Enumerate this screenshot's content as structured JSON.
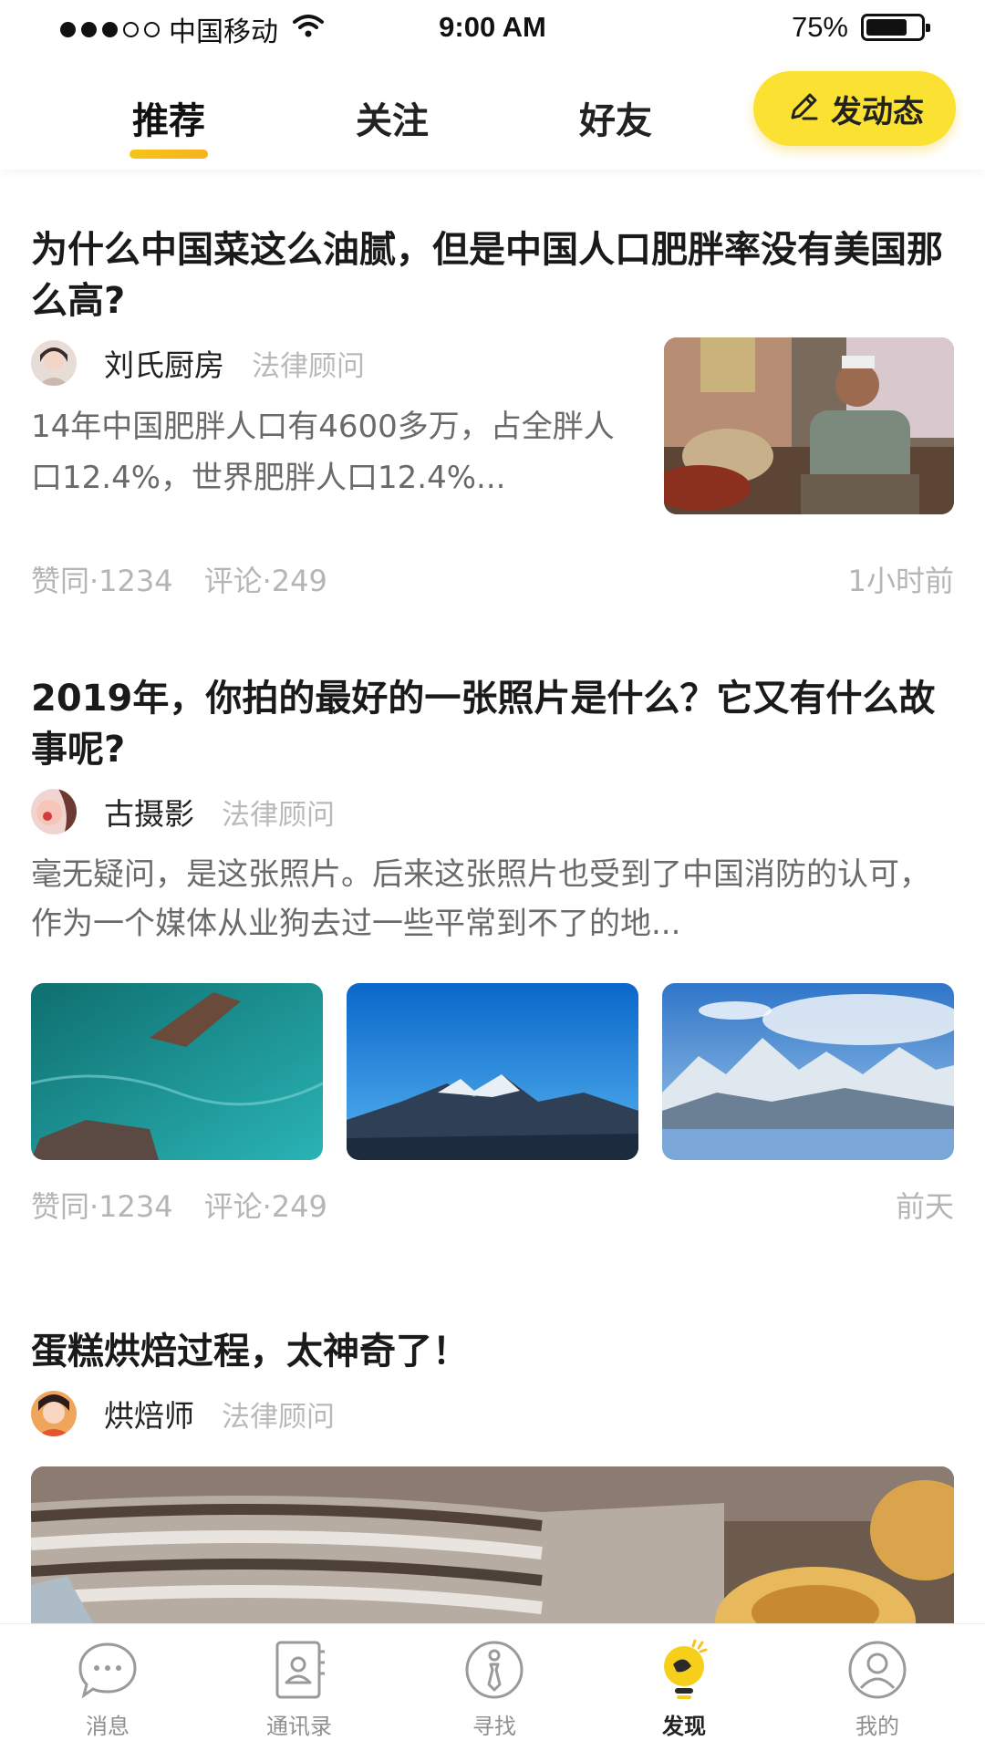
{
  "status_bar": {
    "carrier": "中国移动",
    "time": "9:00 AM",
    "battery": "75%",
    "battery_level": 0.75
  },
  "top_tabs": [
    {
      "label": "推荐",
      "active": true
    },
    {
      "label": "关注",
      "active": false
    },
    {
      "label": "好友",
      "active": false
    }
  ],
  "post_button": {
    "label": "发动态",
    "icon": "pencil-icon"
  },
  "posts": [
    {
      "title": "为什么中国菜这么油腻，但是中国人口肥胖率没有美国那么高?",
      "author": "刘氏厨房",
      "role": "法律顾问",
      "excerpt": "14年中国肥胖人口有4600多万，占全胖人口12.4%，世界肥胖人口12.4%...",
      "likes": "赞同·1234",
      "comments": "评论·249",
      "time": "1小时前"
    },
    {
      "title": "2019年，你拍的最好的一张照片是什么？它又有什么故事呢?",
      "author": "古摄影",
      "role": "法律顾问",
      "excerpt": "毫无疑问，是这张照片。后来这张照片也受到了中国消防的认可，作为一个媒体从业狗去过一些平常到不了的地...",
      "likes": "赞同·1234",
      "comments": "评论·249",
      "time": "前天"
    },
    {
      "title": "蛋糕烘焙过程，太神奇了！",
      "author": "烘焙师",
      "role": "法律顾问"
    }
  ],
  "bottom_nav": [
    {
      "label": "消息",
      "icon": "chat-bubble-icon",
      "active": false
    },
    {
      "label": "通讯录",
      "icon": "contacts-book-icon",
      "active": false
    },
    {
      "label": "寻找",
      "icon": "tie-person-icon",
      "active": false
    },
    {
      "label": "发现",
      "icon": "lightbulb-icon",
      "active": true
    },
    {
      "label": "我的",
      "icon": "user-profile-icon",
      "active": false
    }
  ],
  "colors": {
    "accent": "#fbe132",
    "underline": "#f5c51a",
    "muted_text": "#b5b5b5"
  }
}
